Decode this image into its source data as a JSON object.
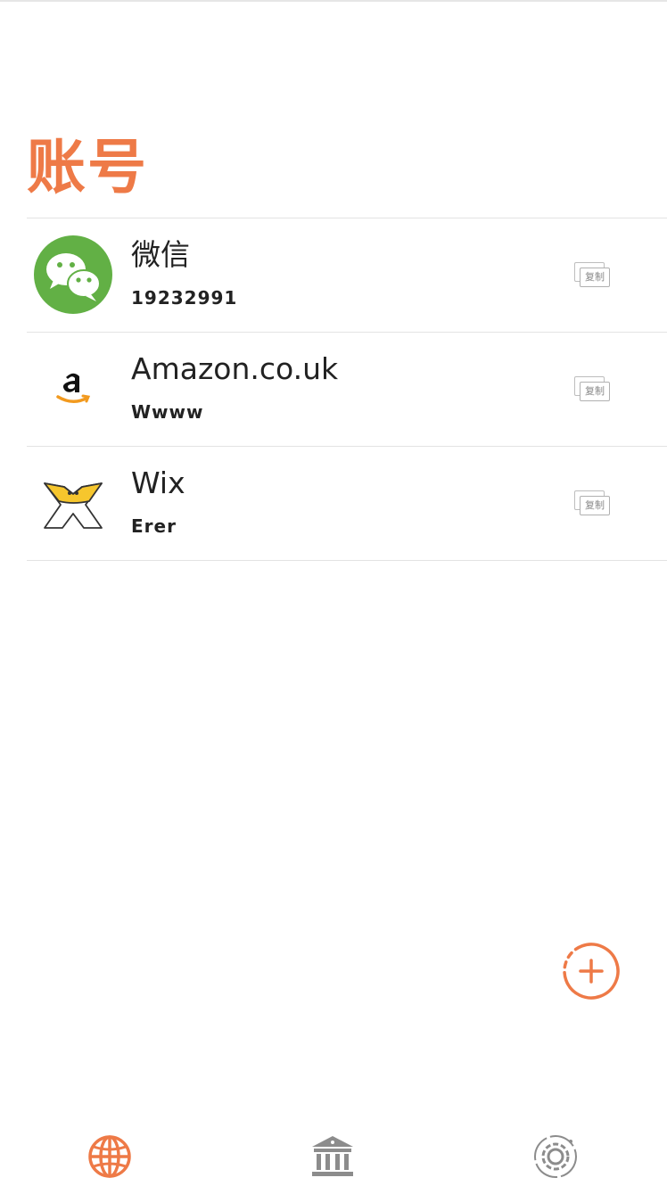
{
  "page": {
    "title": "账号",
    "accent_color": "#ee7a47"
  },
  "accounts": [
    {
      "name": "微信",
      "value": "19232991",
      "icon": "wechat-icon",
      "copy_label": "复制"
    },
    {
      "name": "Amazon.co.uk",
      "value": "Wwww",
      "icon": "amazon-icon",
      "copy_label": "复制"
    },
    {
      "name": "Wix",
      "value": "Erer",
      "icon": "wix-icon",
      "copy_label": "复制"
    }
  ],
  "fab": {
    "icon": "add-circle-icon"
  },
  "tabbar": {
    "items": [
      {
        "icon": "globe-icon",
        "active": true
      },
      {
        "icon": "bank-icon",
        "active": false
      },
      {
        "icon": "gear-icon",
        "active": false
      }
    ]
  }
}
